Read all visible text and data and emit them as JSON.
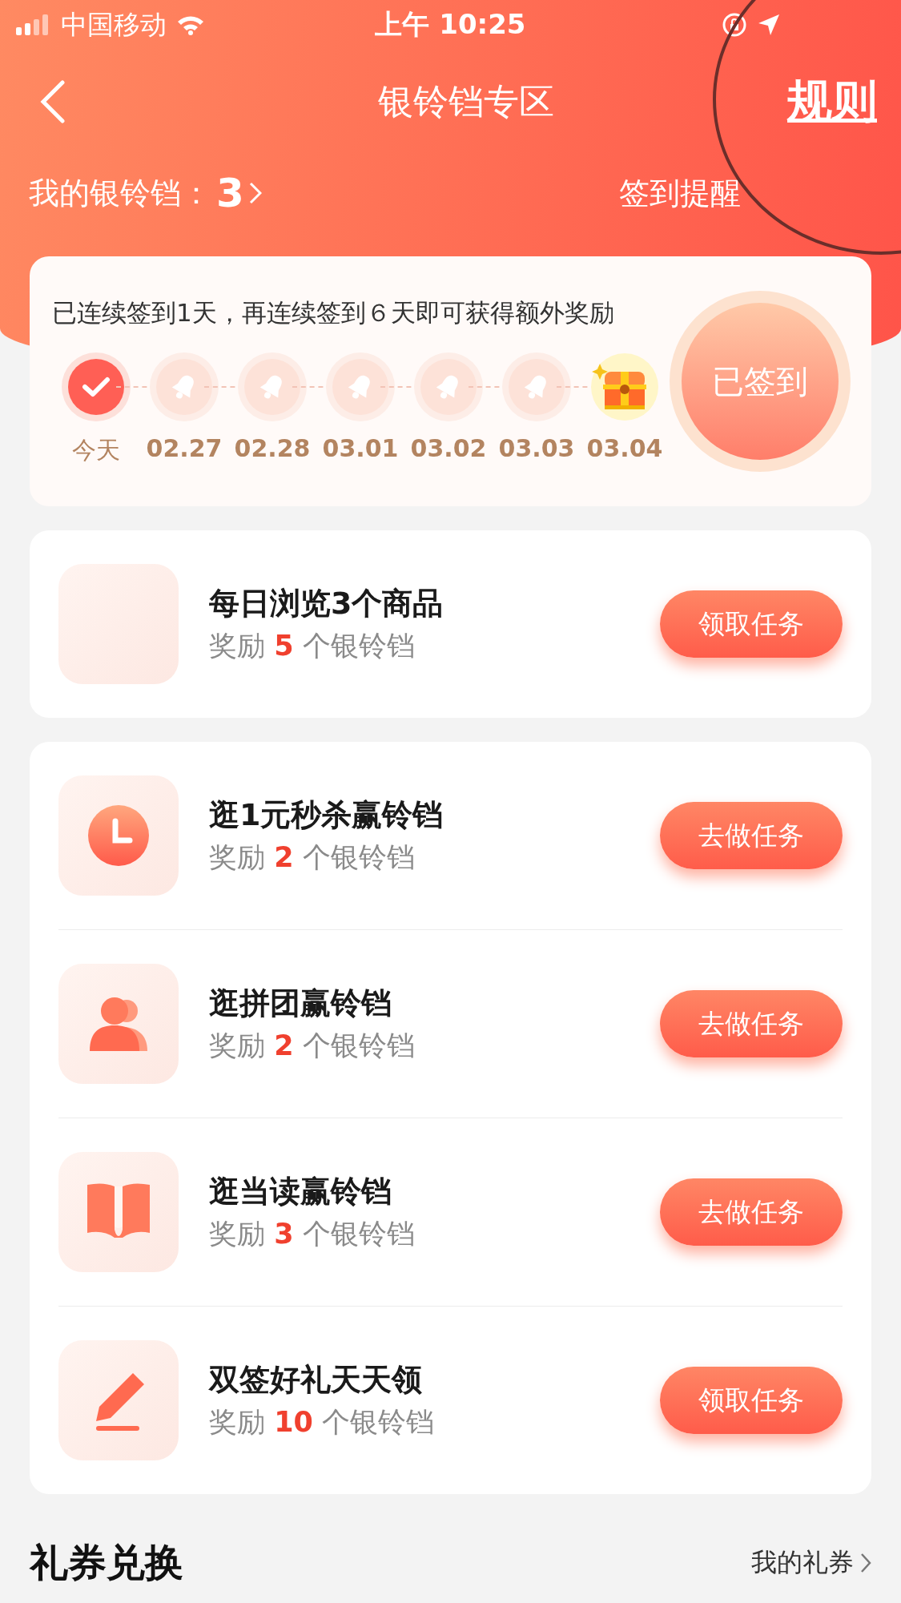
{
  "status_bar": {
    "carrier": "中国移动",
    "time": "上午 10:25"
  },
  "nav": {
    "title": "银铃铛专区",
    "rules": "规则"
  },
  "summary": {
    "label": "我的银铃铛：",
    "count": "3",
    "reminder": "签到提醒"
  },
  "checkin": {
    "message": "已连续签到1天，再连续签到６天即可获得额外奖励",
    "button": "已签到",
    "signed": true,
    "days": [
      {
        "kind": "day",
        "label": "今天",
        "checked": true
      },
      {
        "kind": "day",
        "label": "02.27",
        "checked": false
      },
      {
        "kind": "day",
        "label": "02.28",
        "checked": false
      },
      {
        "kind": "day",
        "label": "03.01",
        "checked": false
      },
      {
        "kind": "day",
        "label": "03.02",
        "checked": false
      },
      {
        "kind": "day",
        "label": "03.03",
        "checked": false
      },
      {
        "kind": "chest",
        "label": "03.04",
        "checked": false
      }
    ]
  },
  "task_groups": [
    {
      "tasks": [
        {
          "kind": "blank",
          "title": "每日浏览3个商品",
          "reward_prefix": "奖励",
          "reward_count": "5",
          "reward_unit": "个银铃铛",
          "button": "领取任务"
        }
      ]
    },
    {
      "tasks": [
        {
          "kind": "clock",
          "title": "逛1元秒杀赢铃铛",
          "reward_prefix": "奖励",
          "reward_count": "2",
          "reward_unit": "个银铃铛",
          "button": "去做任务"
        },
        {
          "kind": "people",
          "title": "逛拼团赢铃铛",
          "reward_prefix": "奖励",
          "reward_count": "2",
          "reward_unit": "个银铃铛",
          "button": "去做任务"
        },
        {
          "kind": "book",
          "title": "逛当读赢铃铛",
          "reward_prefix": "奖励",
          "reward_count": "3",
          "reward_unit": "个银铃铛",
          "button": "去做任务"
        },
        {
          "kind": "pencil",
          "title": "双签好礼天天领",
          "reward_prefix": "奖励",
          "reward_count": "10",
          "reward_unit": "个银铃铛",
          "button": "领取任务"
        }
      ]
    }
  ],
  "coupons": {
    "title": "礼券兑换",
    "link": "我的礼券"
  }
}
